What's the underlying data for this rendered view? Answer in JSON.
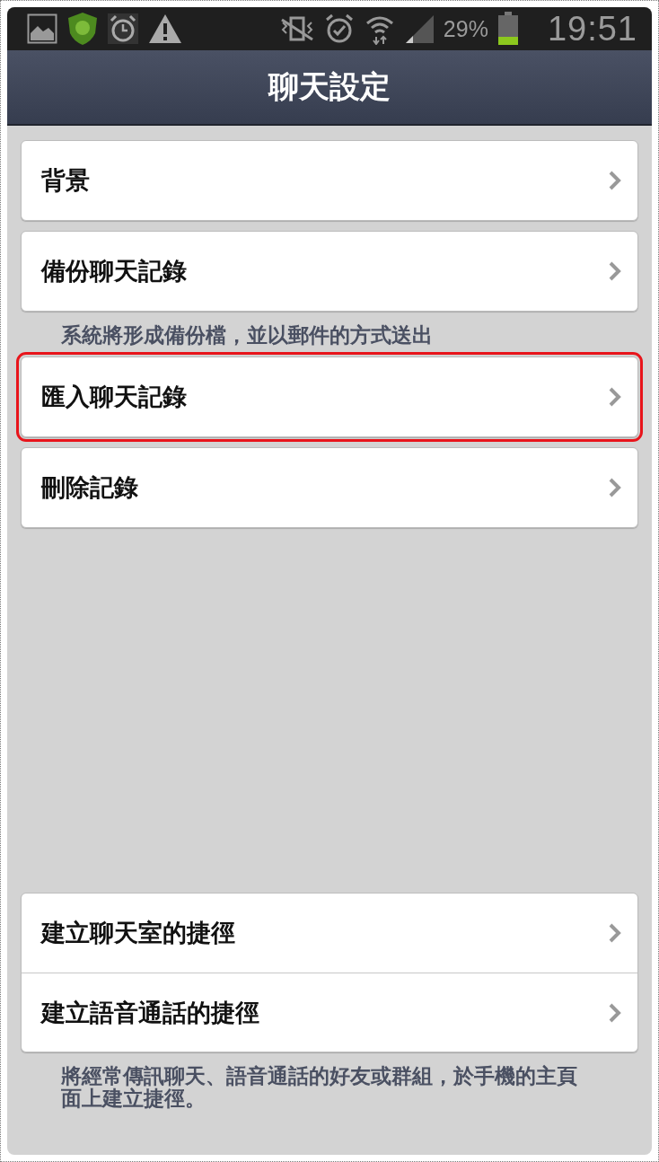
{
  "status_bar": {
    "battery": "29%",
    "time": "19:51"
  },
  "header": {
    "title": "聊天設定"
  },
  "groups": [
    {
      "items": [
        {
          "label": "背景",
          "highlighted": false
        }
      ]
    },
    {
      "items": [
        {
          "label": "備份聊天記錄",
          "highlighted": false
        }
      ],
      "note": "系統將形成備份檔，並以郵件的方式送出"
    },
    {
      "items": [
        {
          "label": "匯入聊天記錄",
          "highlighted": true
        }
      ]
    },
    {
      "items": [
        {
          "label": "刪除記錄",
          "highlighted": false
        }
      ]
    }
  ],
  "bottom_groups": [
    {
      "items": [
        {
          "label": "建立聊天室的捷徑",
          "highlighted": false
        },
        {
          "label": "建立語音通話的捷徑",
          "highlighted": false
        }
      ],
      "note": "將經常傳訊聊天、語音通話的好友或群組，於手機的主頁面上建立捷徑。"
    }
  ]
}
